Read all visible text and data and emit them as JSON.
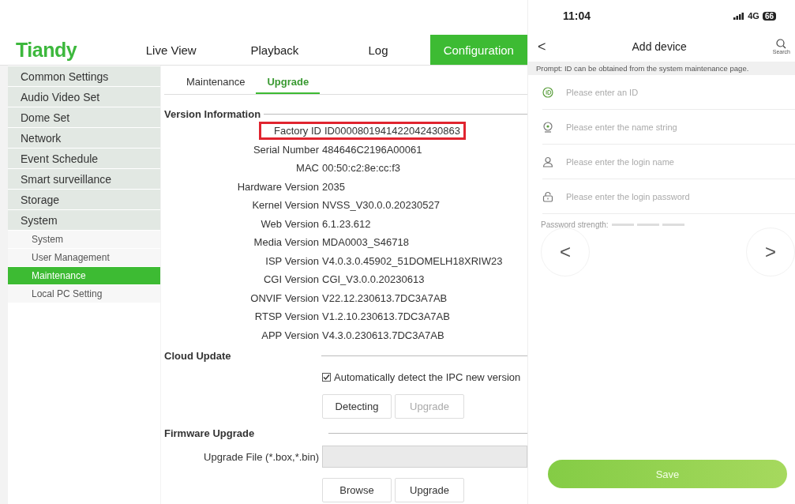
{
  "web": {
    "logo": "Tiandy",
    "nav": [
      {
        "label": "Live View",
        "selected": false
      },
      {
        "label": "Playback",
        "selected": false
      },
      {
        "label": "Log",
        "selected": false
      },
      {
        "label": "Configuration",
        "selected": true
      }
    ],
    "sidebar": {
      "items": [
        {
          "label": "Common Settings",
          "selected": false
        },
        {
          "label": "Audio Video Set",
          "selected": false
        },
        {
          "label": "Dome Set",
          "selected": false
        },
        {
          "label": "Network",
          "selected": false
        },
        {
          "label": "Event Schedule",
          "selected": false
        },
        {
          "label": "Smart surveillance",
          "selected": false
        },
        {
          "label": "Storage",
          "selected": false
        },
        {
          "label": "System",
          "selected": false,
          "children": [
            {
              "label": "System",
              "selected": false
            },
            {
              "label": "User Management",
              "selected": false
            },
            {
              "label": "Maintenance",
              "selected": true
            },
            {
              "label": "Local PC Setting",
              "selected": false
            }
          ]
        }
      ]
    },
    "subtabs": [
      {
        "label": "Maintenance",
        "selected": false
      },
      {
        "label": "Upgrade",
        "selected": true
      }
    ],
    "version_information": {
      "title": "Version Information",
      "rows": [
        {
          "label": "Factory ID",
          "value": "ID0000801941422042430863",
          "highlighted": true
        },
        {
          "label": "Serial Number",
          "value": "484646C2196A00061",
          "highlighted": false
        },
        {
          "label": "MAC",
          "value": "00:50:c2:8e:cc:f3",
          "highlighted": false
        },
        {
          "label": "Hardware Version",
          "value": "2035",
          "highlighted": false
        },
        {
          "label": "Kernel Version",
          "value": "NVSS_V30.0.0.20230527",
          "highlighted": false
        },
        {
          "label": "Web Version",
          "value": "6.1.23.612",
          "highlighted": false
        },
        {
          "label": "Media Version",
          "value": "MDA0003_S46718",
          "highlighted": false
        },
        {
          "label": "ISP Version",
          "value": "V4.0.3.0.45902_51DOMELH18XRIW23",
          "highlighted": false
        },
        {
          "label": "CGI Version",
          "value": "CGI_V3.0.0.20230613",
          "highlighted": false
        },
        {
          "label": "ONVIF Version",
          "value": "V22.12.230613.7DC3A7AB",
          "highlighted": false
        },
        {
          "label": "RTSP Version",
          "value": "V1.2.10.230613.7DC3A7AB",
          "highlighted": false
        },
        {
          "label": "APP Version",
          "value": "V4.3.0.230613.7DC3A7AB",
          "highlighted": false
        }
      ]
    },
    "cloud_update": {
      "title": "Cloud Update",
      "auto_detect": {
        "label": "Automatically detect the IPC new version",
        "checked": true
      },
      "buttons": [
        {
          "label": "Detecting",
          "disabled": false
        },
        {
          "label": "Upgrade",
          "disabled": true
        }
      ]
    },
    "firmware_upgrade": {
      "title": "Firmware Upgrade",
      "file_label": "Upgrade File (*.box,*.bin)",
      "file_field_disabled": true,
      "buttons": [
        {
          "label": "Browse",
          "disabled": false
        },
        {
          "label": "Upgrade",
          "disabled": false
        }
      ]
    }
  },
  "phone": {
    "status_bar": {
      "time": "11:04",
      "network": "4G",
      "battery": "66"
    },
    "header": {
      "back": "<",
      "title": "Add device",
      "search_label": "Search"
    },
    "prompt": "Prompt: ID can be obtained from the system maintenance page.",
    "fields": [
      {
        "kind": "id",
        "placeholder": "Please enter an ID"
      },
      {
        "kind": "camera",
        "placeholder": "Please enter the name string"
      },
      {
        "kind": "user",
        "placeholder": "Please enter the login name"
      },
      {
        "kind": "lock",
        "placeholder": "Please enter the login password"
      }
    ],
    "password_strength": {
      "label": "Password strength:"
    },
    "arrows": [
      "<",
      ">"
    ],
    "save": "Save"
  }
}
